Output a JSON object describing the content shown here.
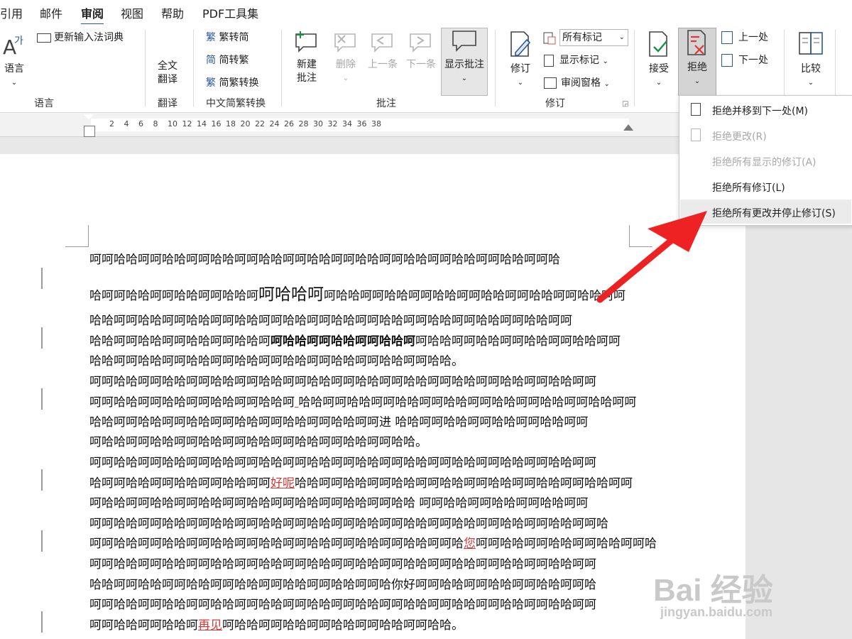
{
  "tabs": [
    "引用",
    "邮件",
    "审阅",
    "视图",
    "帮助",
    "PDF工具集"
  ],
  "ribbon": {
    "lang": {
      "btn": "语言",
      "update": "更新输入法词典",
      "group": "语言"
    },
    "translate": {
      "btn_l1": "全文",
      "btn_l2": "翻译",
      "group": "翻译"
    },
    "chinese": {
      "fan2jian": "繁转简",
      "jian2fan": "简转繁",
      "convert": "简繁转换",
      "group": "中文简繁转换"
    },
    "comments": {
      "new_l1": "新建",
      "new_l2": "批注",
      "delete": "删除",
      "prev": "上一条",
      "next": "下一条",
      "show": "显示批注",
      "group": "批注"
    },
    "tracking": {
      "track": "修订",
      "all_markup": "所有标记",
      "show_markup": "显示标记",
      "review_pane": "审阅窗格",
      "group": "修订"
    },
    "changes": {
      "accept": "接受",
      "reject": "拒绝",
      "prev": "上一处",
      "next": "下一处"
    },
    "compare": {
      "btn": "比较"
    }
  },
  "ruler_numbers": [
    "2",
    "4",
    "6",
    "8",
    "10",
    "12",
    "14",
    "16",
    "18",
    "20",
    "22",
    "24",
    "26",
    "28",
    "30",
    "32",
    "34",
    "36",
    "38"
  ],
  "reject_menu": [
    {
      "label": "拒绝并移到下一处(M)",
      "enabled": true
    },
    {
      "label": "拒绝更改(R)",
      "enabled": false
    },
    {
      "label": "拒绝所有显示的修订(A)",
      "enabled": false
    },
    {
      "label": "拒绝所有修订(L)",
      "enabled": true
    },
    {
      "label": "拒绝所有更改并停止修订(S)",
      "enabled": true,
      "highlighted": true
    }
  ],
  "doc": {
    "l1": "呵呵哈哈呵呵哈哈呵呵哈哈呵呵哈哈呵呵哈哈呵呵哈哈呵呵哈哈呵呵哈哈呵呵哈哈呵呵哈",
    "l2a": "哈呵呵哈哈呵呵哈哈呵呵哈哈呵",
    "l2b": "呵哈哈呵",
    "l2c": "呵哈哈呵呵哈哈呵呵哈哈呵呵哈哈呵呵哈哈呵呵哈哈呵呵",
    "l3": "哈哈呵呵哈哈呵呵哈哈呵呵哈哈呵呵哈哈呵呵哈哈呵呵哈哈呵呵哈哈呵呵哈哈呵呵哈哈呵呵",
    "l4a": "哈哈呵呵哈哈呵呵哈哈呵呵哈哈呵",
    "l4b": "呵哈哈呵呵哈哈呵呵哈哈呵",
    "l4c": "呵哈哈呵呵哈哈呵呵哈哈呵呵哈哈呵呵",
    "l5": "哈哈呵呵哈哈呵呵哈哈呵呵哈哈呵呵哈哈呵呵哈哈呵呵哈哈呵呵哈哈。",
    "l6": "呵呵哈哈呵呵哈哈呵呵哈哈呵呵哈哈呵呵哈哈呵呵哈哈呵呵哈哈呵呵哈哈呵呵哈哈呵呵哈哈呵呵",
    "l7a": "呵呵哈哈呵呵哈哈呵呵哈哈呵呵哈哈呵",
    "l7b": "  ",
    "l7c": "哈哈呵呵哈哈呵呵哈哈呵呵哈哈呵呵哈哈呵呵哈哈呵呵哈哈呵呵",
    "l8": "哈哈呵呵哈哈呵呵哈哈呵呵哈哈呵呵哈哈呵呵哈哈呵呵进  哈哈呵呵哈哈呵呵哈哈呵呵哈哈呵呵",
    "l9": "呵哈哈呵呵哈哈呵呵哈哈呵呵哈哈呵呵哈哈呵呵哈哈呵呵哈哈。",
    "l10": "呵呵哈哈呵呵哈哈呵呵哈哈呵呵哈哈呵呵哈哈呵呵哈哈呵呵哈哈呵呵哈哈呵呵哈哈呵呵哈哈呵呵",
    "l11a": "哈呵呵哈哈呵呵哈哈呵呵哈哈呵呵",
    "l11b": "好呢",
    "l11c": "哈哈呵呵哈哈呵呵哈哈呵呵哈哈呵呵哈哈呵呵哈哈呵呵哈哈呵呵",
    "l12": "呵哈哈呵呵哈哈呵呵哈哈呵呵哈哈呵呵哈哈呵呵哈哈呵呵哈哈    呵呵哈哈呵呵哈哈呵呵哈哈呵呵",
    "l13": "呵呵哈哈呵呵哈哈呵呵哈哈呵呵哈哈呵呵哈哈呵呵哈哈呵呵哈哈呵呵哈哈呵呵哈哈呵呵哈哈呵呵哈",
    "l14a": "呵呵哈哈呵呵哈哈呵呵哈哈呵呵哈哈呵呵哈哈呵呵哈哈呵呵哈哈呵呵哈",
    "l14b": "您",
    "l14c": "呵呵哈哈呵呵哈哈呵呵哈哈呵呵哈",
    "l15": "呵呵哈哈呵呵哈哈呵呵哈哈呵呵哈哈呵呵哈哈呵呵哈哈呵呵哈哈呵呵哈哈呵呵哈哈呵呵哈哈呵呵",
    "l16": "哈哈呵呵哈哈呵呵哈哈呵呵哈哈呵呵哈哈呵呵哈哈呵呵哈你好呵呵哈哈呵呵哈哈呵呵哈哈呵呵哈",
    "l17": "呵呵哈哈呵呵哈哈呵呵哈哈呵呵哈哈呵呵哈哈呵呵哈哈呵呵哈哈呵呵哈哈呵呵哈哈呵呵哈哈呵呵",
    "l18a": "呵呵哈哈呵呵哈哈呵",
    "l18b": "再见",
    "l18c": "呵哈哈呵呵哈哈呵呵哈哈呵呵哈哈呵呵哈哈。"
  },
  "watermark": {
    "main": "Bai 经验",
    "sub": "jingyan.baidu.com"
  }
}
